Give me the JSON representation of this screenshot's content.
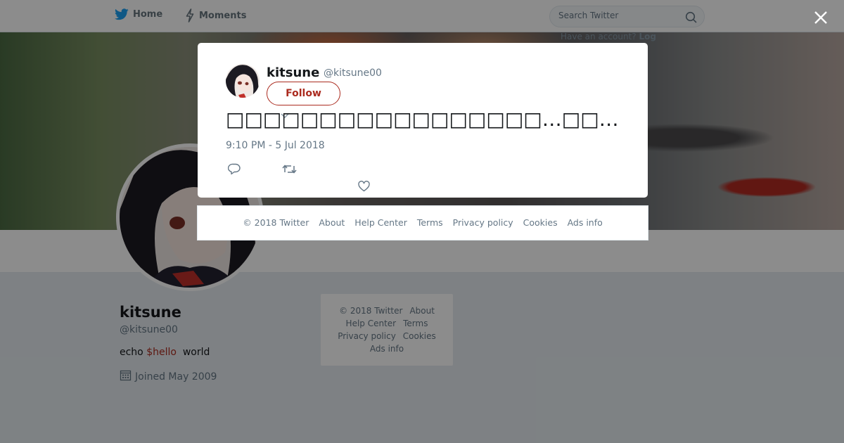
{
  "nav": {
    "home_label": "Home",
    "moments_label": "Moments",
    "search_placeholder": "Search Twitter",
    "have_account": "Have an account?",
    "login_label": "Log"
  },
  "profile": {
    "name": "kitsune",
    "handle": "@kitsune00",
    "bio_prefix": "echo ",
    "bio_var": "$hello",
    "bio_suffix": "  world",
    "joined": "Joined May 2009"
  },
  "sidebar_footer": {
    "line1": [
      "© 2018 Twitter",
      "About"
    ],
    "line2": [
      "Help Center",
      "Terms"
    ],
    "line3": [
      "Privacy policy",
      "Cookies"
    ],
    "line4": [
      "Ads info"
    ]
  },
  "tweet": {
    "author_name": "kitsune",
    "author_handle": "@kitsune00",
    "follow_label": "Follow",
    "text": "□□□□□□□□□□□□□□□□□…□□…",
    "timestamp": "9:10 PM - 5 Jul 2018"
  },
  "modal_footer": {
    "items": [
      "© 2018 Twitter",
      "About",
      "Help Center",
      "Terms",
      "Privacy policy",
      "Cookies",
      "Ads info"
    ]
  },
  "colors": {
    "accent": "#ab2b1f",
    "twitter_blue": "#1da1f2",
    "muted": "#657786"
  },
  "icons": {
    "home": "twitter-bird-icon",
    "moments": "lightning-icon",
    "search": "search-icon",
    "close": "close-icon",
    "reply": "reply-icon",
    "retweet": "retweet-icon",
    "like": "heart-icon",
    "joined": "calendar-icon",
    "caret": "chevron-down-icon"
  }
}
